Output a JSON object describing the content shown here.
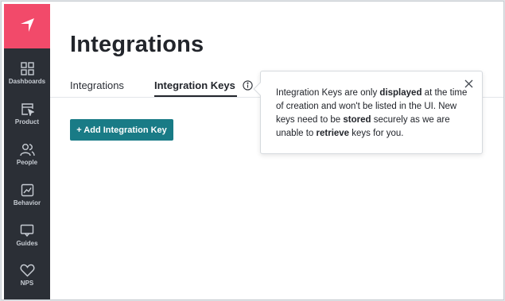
{
  "sidebar": {
    "logo": "brand-logo",
    "accent_color": "#f24a6a",
    "items": [
      {
        "label": "Dashboards",
        "icon": "grid-icon"
      },
      {
        "label": "Product",
        "icon": "cursor-window-icon"
      },
      {
        "label": "People",
        "icon": "people-icon"
      },
      {
        "label": "Behavior",
        "icon": "chart-icon"
      },
      {
        "label": "Guides",
        "icon": "message-icon"
      },
      {
        "label": "NPS",
        "icon": "heart-icon"
      }
    ]
  },
  "main": {
    "title": "Integrations",
    "tabs": [
      {
        "label": "Integrations",
        "active": false
      },
      {
        "label": "Integration Keys",
        "active": true
      }
    ],
    "add_button_label": "+ Add Integration Key",
    "button_color": "#197b86"
  },
  "tooltip": {
    "segments": [
      {
        "text": "Integration Keys are only ",
        "bold": false
      },
      {
        "text": "displayed",
        "bold": true
      },
      {
        "text": " at the time of creation and won't be listed in the UI. New keys need to be ",
        "bold": false
      },
      {
        "text": "stored",
        "bold": true
      },
      {
        "text": " securely as we are unable to ",
        "bold": false
      },
      {
        "text": "retrieve",
        "bold": true
      },
      {
        "text": " keys for you.",
        "bold": false
      }
    ]
  }
}
